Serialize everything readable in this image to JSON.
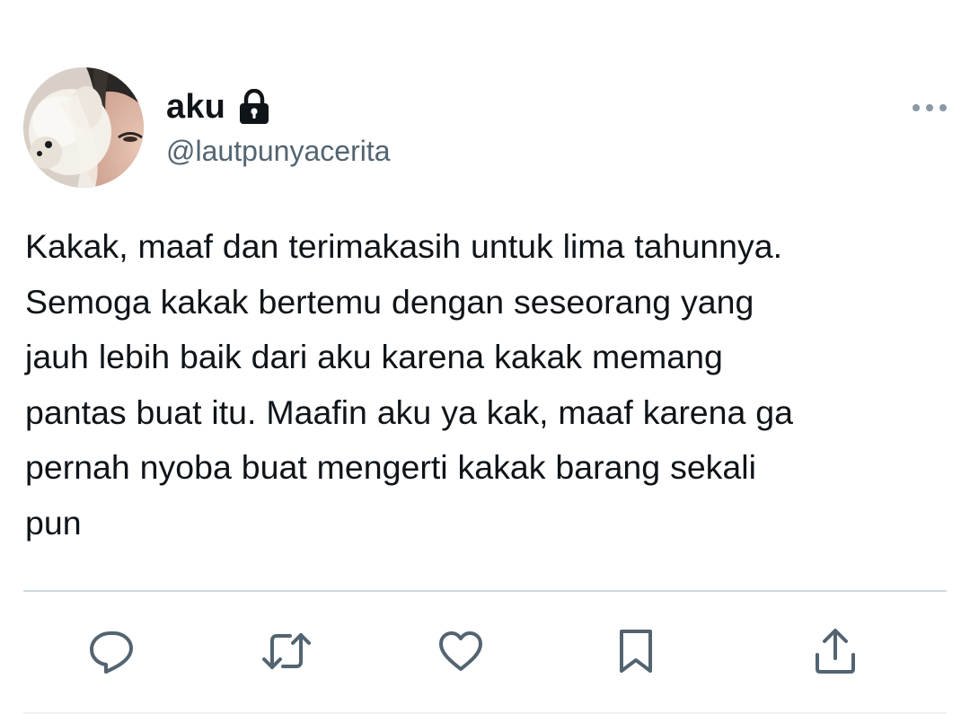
{
  "tweet": {
    "author": {
      "display_name": "aku",
      "handle": "@lautpunyacerita",
      "protected": true,
      "avatar": "profile-photo"
    },
    "text": "Kakak, maaf dan terimakasih untuk lima tahunnya.\nSemoga kakak bertemu dengan seseorang yang\njauh lebih baik dari aku karena kakak memang\npantas buat itu. Maafin aku ya kak, maaf karena ga\npernah nyoba buat mengerti kakak barang sekali\npun"
  },
  "actions": [
    {
      "icon": "reply-icon"
    },
    {
      "icon": "retweet-icon"
    },
    {
      "icon": "like-icon"
    },
    {
      "icon": "bookmark-icon"
    },
    {
      "icon": "share-icon"
    }
  ],
  "colors": {
    "text_primary": "#0f1419",
    "text_secondary": "#536471",
    "divider": "#cfd9de",
    "icon": "#536471"
  }
}
